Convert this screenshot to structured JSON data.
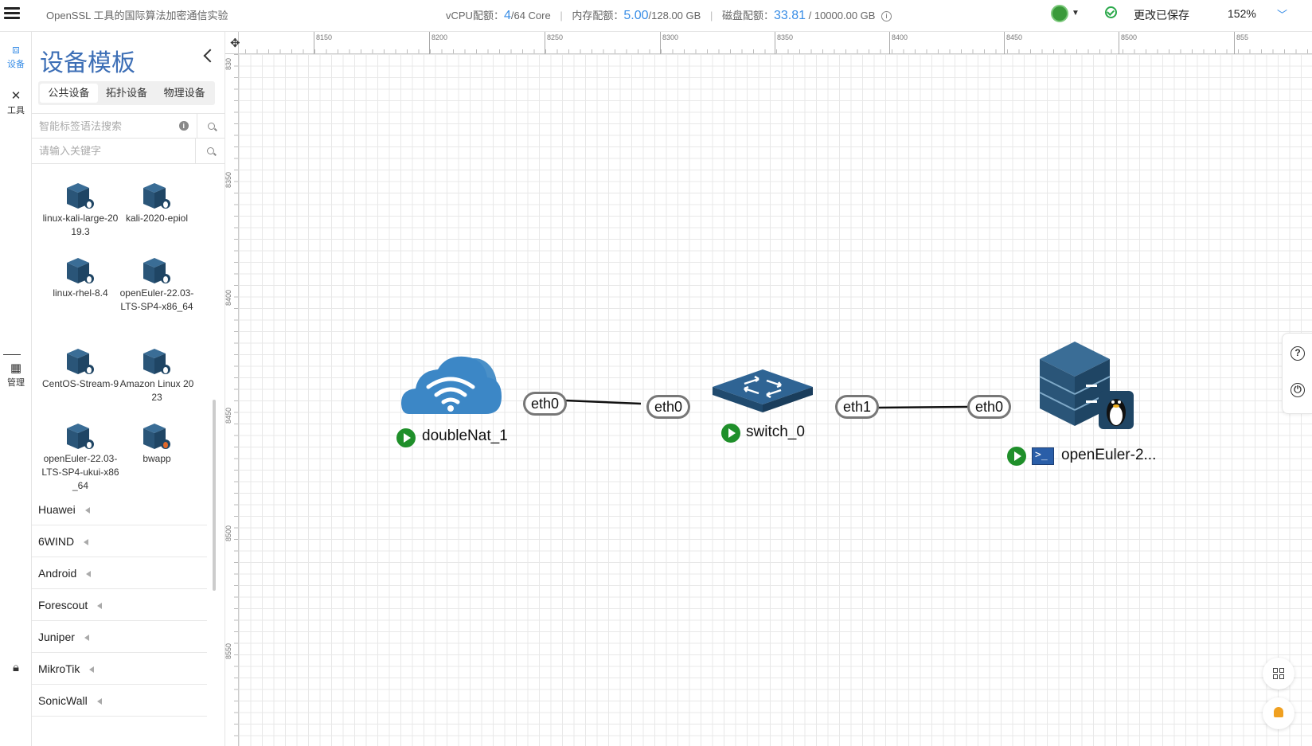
{
  "header": {
    "lab_title": "OpenSSL 工具的国际算法加密通信实验",
    "vcpu_label": "vCPU配额：",
    "vcpu_used": "4",
    "vcpu_total": "/64 Core",
    "mem_label": "内存配额：",
    "mem_used": "5.00",
    "mem_total": "/128.00 GB",
    "disk_label": "磁盘配额：",
    "disk_used": "33.81",
    "disk_total": " / 10000.00 GB",
    "save_status": "更改已保存",
    "zoom": "152%"
  },
  "rail": {
    "devices": "设备",
    "tools": "工具",
    "manage": "管理"
  },
  "panel": {
    "title": "设备模板",
    "tabs": [
      "公共设备",
      "拓扑设备",
      "物理设备"
    ],
    "active_tab": 0,
    "search_tag_placeholder": "智能标签语法搜索",
    "search_keyword_placeholder": "请输入关键字",
    "devices": [
      {
        "name": "linux-kali-large-2019.3",
        "icon": "linux-server-icon"
      },
      {
        "name": "kali-2020-epiol",
        "icon": "linux-server-icon"
      },
      {
        "name": "linux-rhel-8.4",
        "icon": "linux-server-icon"
      },
      {
        "name": "openEuler-22.03-LTS-SP4-x86_64",
        "icon": "linux-server-icon"
      },
      {
        "name": "CentOS-Stream-9",
        "icon": "linux-server-icon"
      },
      {
        "name": "Amazon Linux 2023",
        "icon": "linux-server-icon"
      },
      {
        "name": "openEuler-22.03-LTS-SP4-ukui-x86_64",
        "icon": "linux-server-icon"
      },
      {
        "name": "bwapp",
        "icon": "web-server-icon"
      }
    ],
    "vendors": [
      "Huawei",
      "6WIND",
      "Android",
      "Forescout",
      "Juniper",
      "MikroTik",
      "SonicWall"
    ]
  },
  "canvas": {
    "ruler_x": [
      "8150",
      "8200",
      "8250",
      "8300",
      "8350",
      "8400",
      "8450",
      "8500",
      "855"
    ],
    "ruler_y": [
      "830",
      "8350",
      "8400",
      "8450",
      "8500",
      "8550"
    ],
    "nodes": [
      {
        "name": "doubleNat_1",
        "type": "cloud-nat",
        "status": "running"
      },
      {
        "name": "switch_0",
        "type": "switch",
        "status": "running"
      },
      {
        "name": "openEuler-2...",
        "type": "linux-server",
        "status": "running"
      }
    ],
    "ports": {
      "nat_eth0": "eth0",
      "switch_eth0": "eth0",
      "switch_eth1": "eth1",
      "server_eth0": "eth0"
    }
  },
  "colors": {
    "accent": "#3a8ee6",
    "title_blue": "#3d6fb6",
    "running": "#1f8f2a",
    "device_icon": "#2f5f82"
  }
}
